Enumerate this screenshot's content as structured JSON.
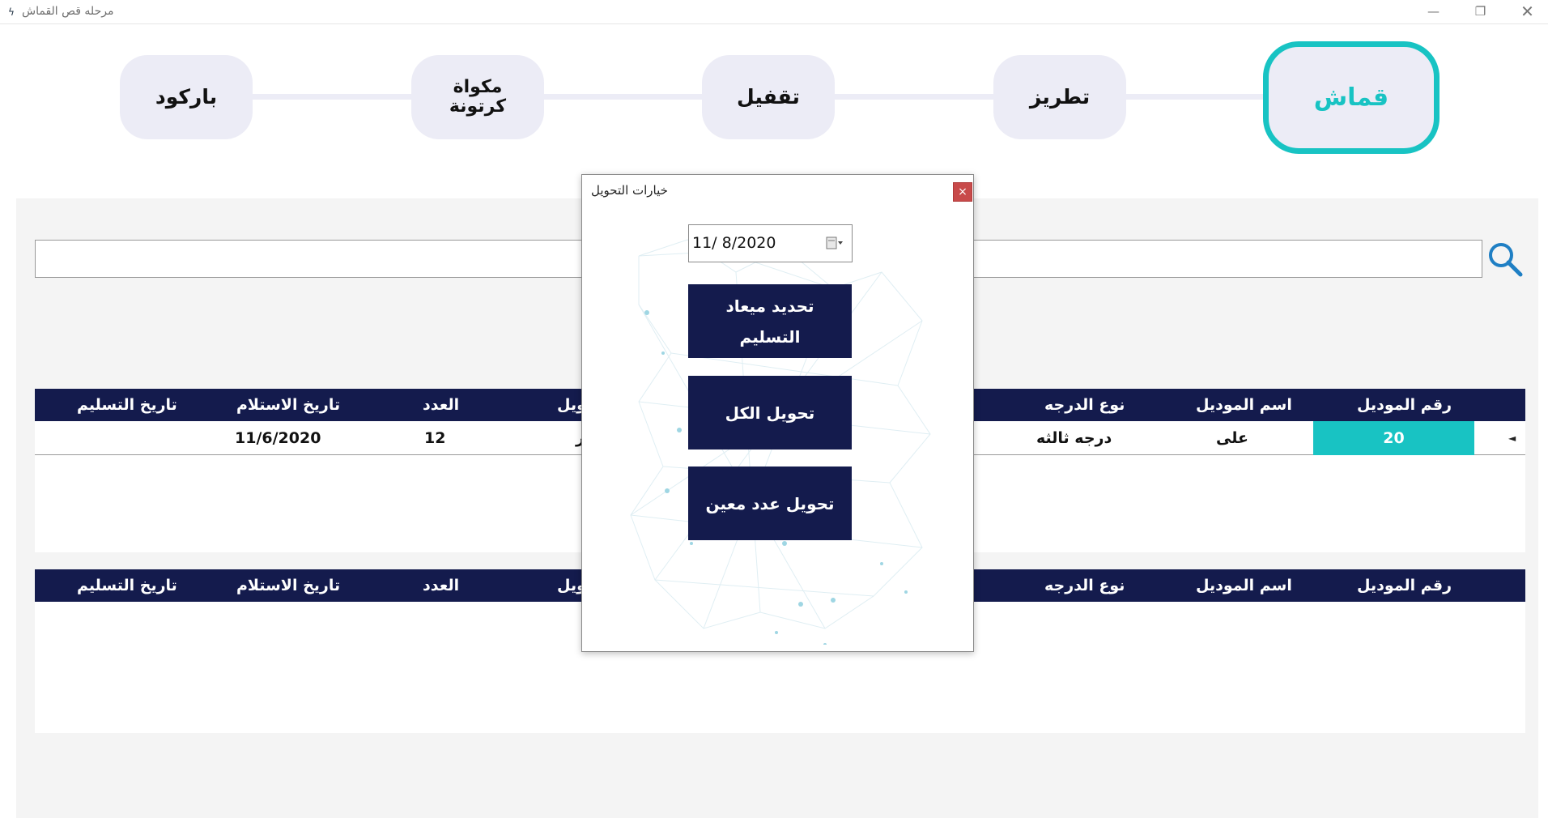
{
  "window": {
    "title": "مرحله قص القماش",
    "min": "—",
    "max": "❐",
    "close": "✕"
  },
  "steps": [
    {
      "label": "قماش"
    },
    {
      "label": "تطريز"
    },
    {
      "label": "تقفيل"
    },
    {
      "label": "مكواة كرتونة"
    },
    {
      "label": "باركود"
    }
  ],
  "search": {
    "value": "",
    "icon": "search-icon"
  },
  "grid1": {
    "headers": [
      "رقم الموديل",
      "اسم الموديل",
      "نوع الدرجه",
      "",
      "العدد",
      "تاريخ الاستلام",
      "تاريخ التسليم"
    ],
    "header_partial": "حويل",
    "row": {
      "model_no": "20",
      "model_name": "على",
      "grade": "درجه ثالثه",
      "partial": "ر",
      "count": "12",
      "received": "11/6/2020",
      "delivered": ""
    }
  },
  "grid2": {
    "headers": [
      "رقم الموديل",
      "اسم الموديل",
      "نوع الدرجه",
      "",
      "العدد",
      "تاريخ الاستلام",
      "تاريخ التسليم"
    ],
    "header_partial": "حويل"
  },
  "dialog": {
    "title": "خيارات التحويل",
    "close": "×",
    "date": "11/  8/2020",
    "btn_set_date": "تحديد ميعاد التسليم",
    "btn_transfer_all": "تحويل الكل",
    "btn_transfer_count": "تحويل عدد معين"
  },
  "colors": {
    "navy": "#141b4d",
    "teal": "#18c3c3",
    "step_bg": "#ececf6",
    "close_red": "#c84a4a"
  }
}
